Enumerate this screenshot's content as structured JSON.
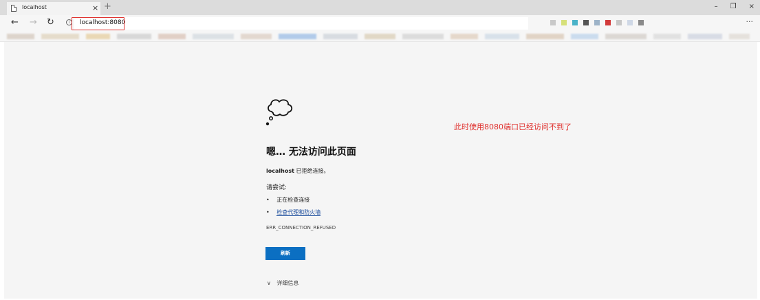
{
  "tab": {
    "title": "localhost",
    "close": "×",
    "new_tab": "+"
  },
  "window_controls": {
    "minimize": "–",
    "restore": "❐",
    "close": "×"
  },
  "toolbar": {
    "back": "←",
    "forward": "→",
    "reload": "↻",
    "info": "i",
    "address": "localhost:8080",
    "more": "···"
  },
  "extension_colors": [
    "#c9c9c9",
    "#d6e07a",
    "#4ab2c8",
    "#555555",
    "#9db3c8",
    "#d23a3a",
    "#c7c7c7",
    "#cfd8e6",
    "#8a8a8a"
  ],
  "error_page": {
    "title": "嗯… 无法访问此页面",
    "host": "localhost",
    "host_message": "已拒绝连接。",
    "try_label": "请尝试:",
    "suggestion_1": "正在检查连接",
    "suggestion_2": "检查代理和防火墙",
    "bullet": "•",
    "error_code": "ERR_CONNECTION_REFUSED",
    "refresh_button": "刷新",
    "details_chevron": "∨",
    "details_label": "详细信息"
  },
  "annotation": {
    "text": "此时使用8080端口已经访问不到了",
    "color": "#e0322f"
  }
}
